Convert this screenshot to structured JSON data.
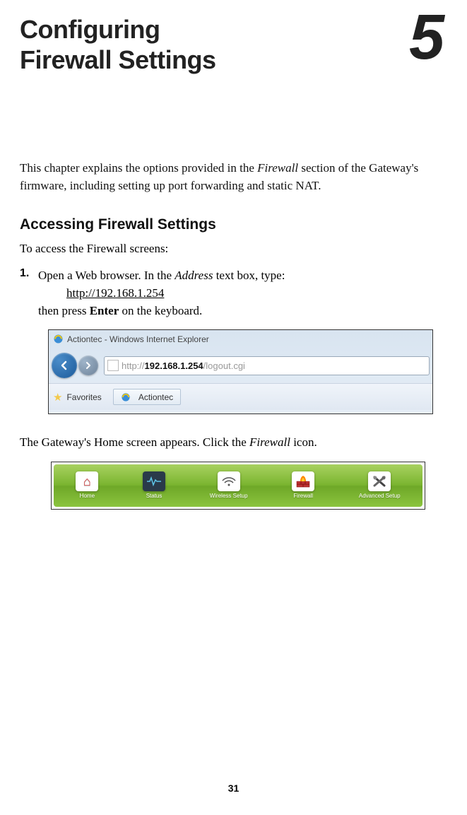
{
  "chapter": {
    "title_line1": "Configuring",
    "title_line2": "Firewall Settings",
    "number": "5"
  },
  "intro": {
    "pre": "This chapter explains the options provided in the ",
    "italic": "Firewall",
    "post": " section of the Gateway's firmware, including setting up port forwarding and static NAT."
  },
  "section_heading": "Accessing Firewall Settings",
  "access_text": "To access the Firewall screens:",
  "step1": {
    "number": "1.",
    "pre": "Open a Web browser. In the ",
    "italic": "Address",
    "post": " text box, type:",
    "url": "http://192.168.1.254",
    "then_pre": "then press ",
    "bold": "Enter",
    "then_post": " on the keyboard."
  },
  "ie": {
    "titlebar": "Actiontec - Windows Internet Explorer",
    "url_prefix": "http://",
    "url_main": "192.168.1.254",
    "url_suffix": "/logout.cgi",
    "favorites_label": "Favorites",
    "tab_label": "Actiontec"
  },
  "gateway_text": {
    "pre": "The Gateway's Home screen appears. Click the ",
    "italic": "Firewall",
    "post": " icon."
  },
  "navbar": {
    "items": [
      {
        "label": "Home",
        "icon": "🏠"
      },
      {
        "label": "Status",
        "icon": "📊"
      },
      {
        "label": "Wireless Setup",
        "icon": "📶"
      },
      {
        "label": "Firewall",
        "icon": "🔥"
      },
      {
        "label": "Advanced Setup",
        "icon": "✖"
      }
    ]
  },
  "page_number": "31"
}
